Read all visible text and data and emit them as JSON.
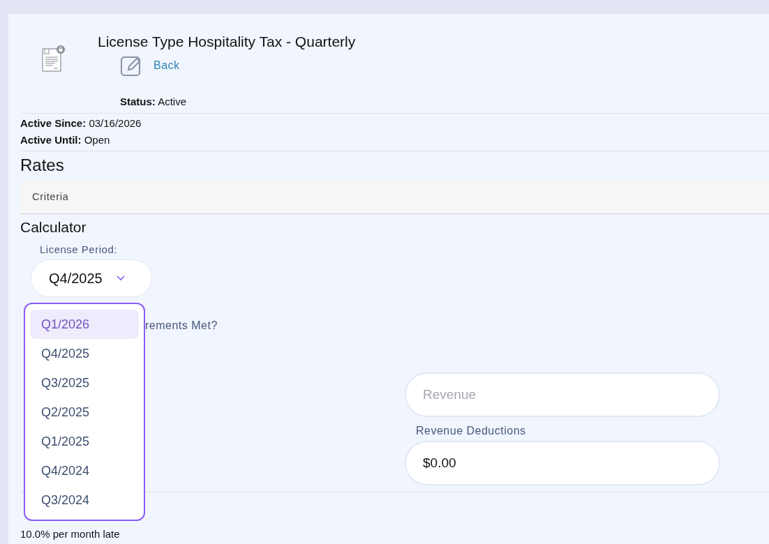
{
  "header": {
    "title": "License Type Hospitality Tax - Quarterly",
    "back_link": "Back",
    "status_label": "Status:",
    "status_value": "Active"
  },
  "dates": [
    {
      "label": "Active Since:",
      "value": "03/16/2026"
    },
    {
      "label": "Active Until:",
      "value": "Open"
    }
  ],
  "rates": {
    "heading": "Rates",
    "criteria": "Criteria"
  },
  "calculator": {
    "heading": "Calculator",
    "period_label": "License Period:",
    "period_value": "Q4/2025",
    "requirements_label": "rements Met?",
    "period_options": [
      {
        "label": "Q1/2026",
        "selected": true
      },
      {
        "label": "Q4/2025",
        "selected": false
      },
      {
        "label": "Q3/2025",
        "selected": false
      },
      {
        "label": "Q2/2025",
        "selected": false
      },
      {
        "label": "Q1/2025",
        "selected": false
      },
      {
        "label": "Q4/2024",
        "selected": false
      },
      {
        "label": "Q3/2024",
        "selected": false
      }
    ],
    "revenue": {
      "placeholder": "Revenue"
    },
    "deductions": {
      "label": "Revenue Deductions",
      "value": "$0.00"
    }
  },
  "penalty": "10.0% per month late"
}
